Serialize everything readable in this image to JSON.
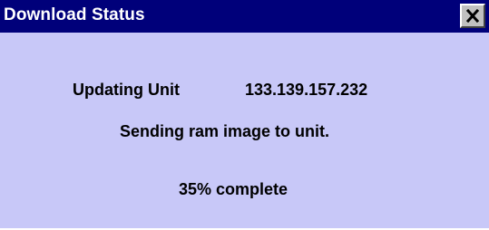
{
  "window": {
    "title": "Download Status"
  },
  "status": {
    "unit_label": "Updating Unit",
    "unit_address": "133.139.157.232",
    "message": "Sending ram image to unit.",
    "progress_text": "35% complete",
    "progress_percent": 35
  },
  "colors": {
    "titlebar": "#00007a",
    "body_background": "#c8c8f8",
    "title_text": "#ffffff"
  },
  "icons": {
    "close": "close-icon"
  }
}
